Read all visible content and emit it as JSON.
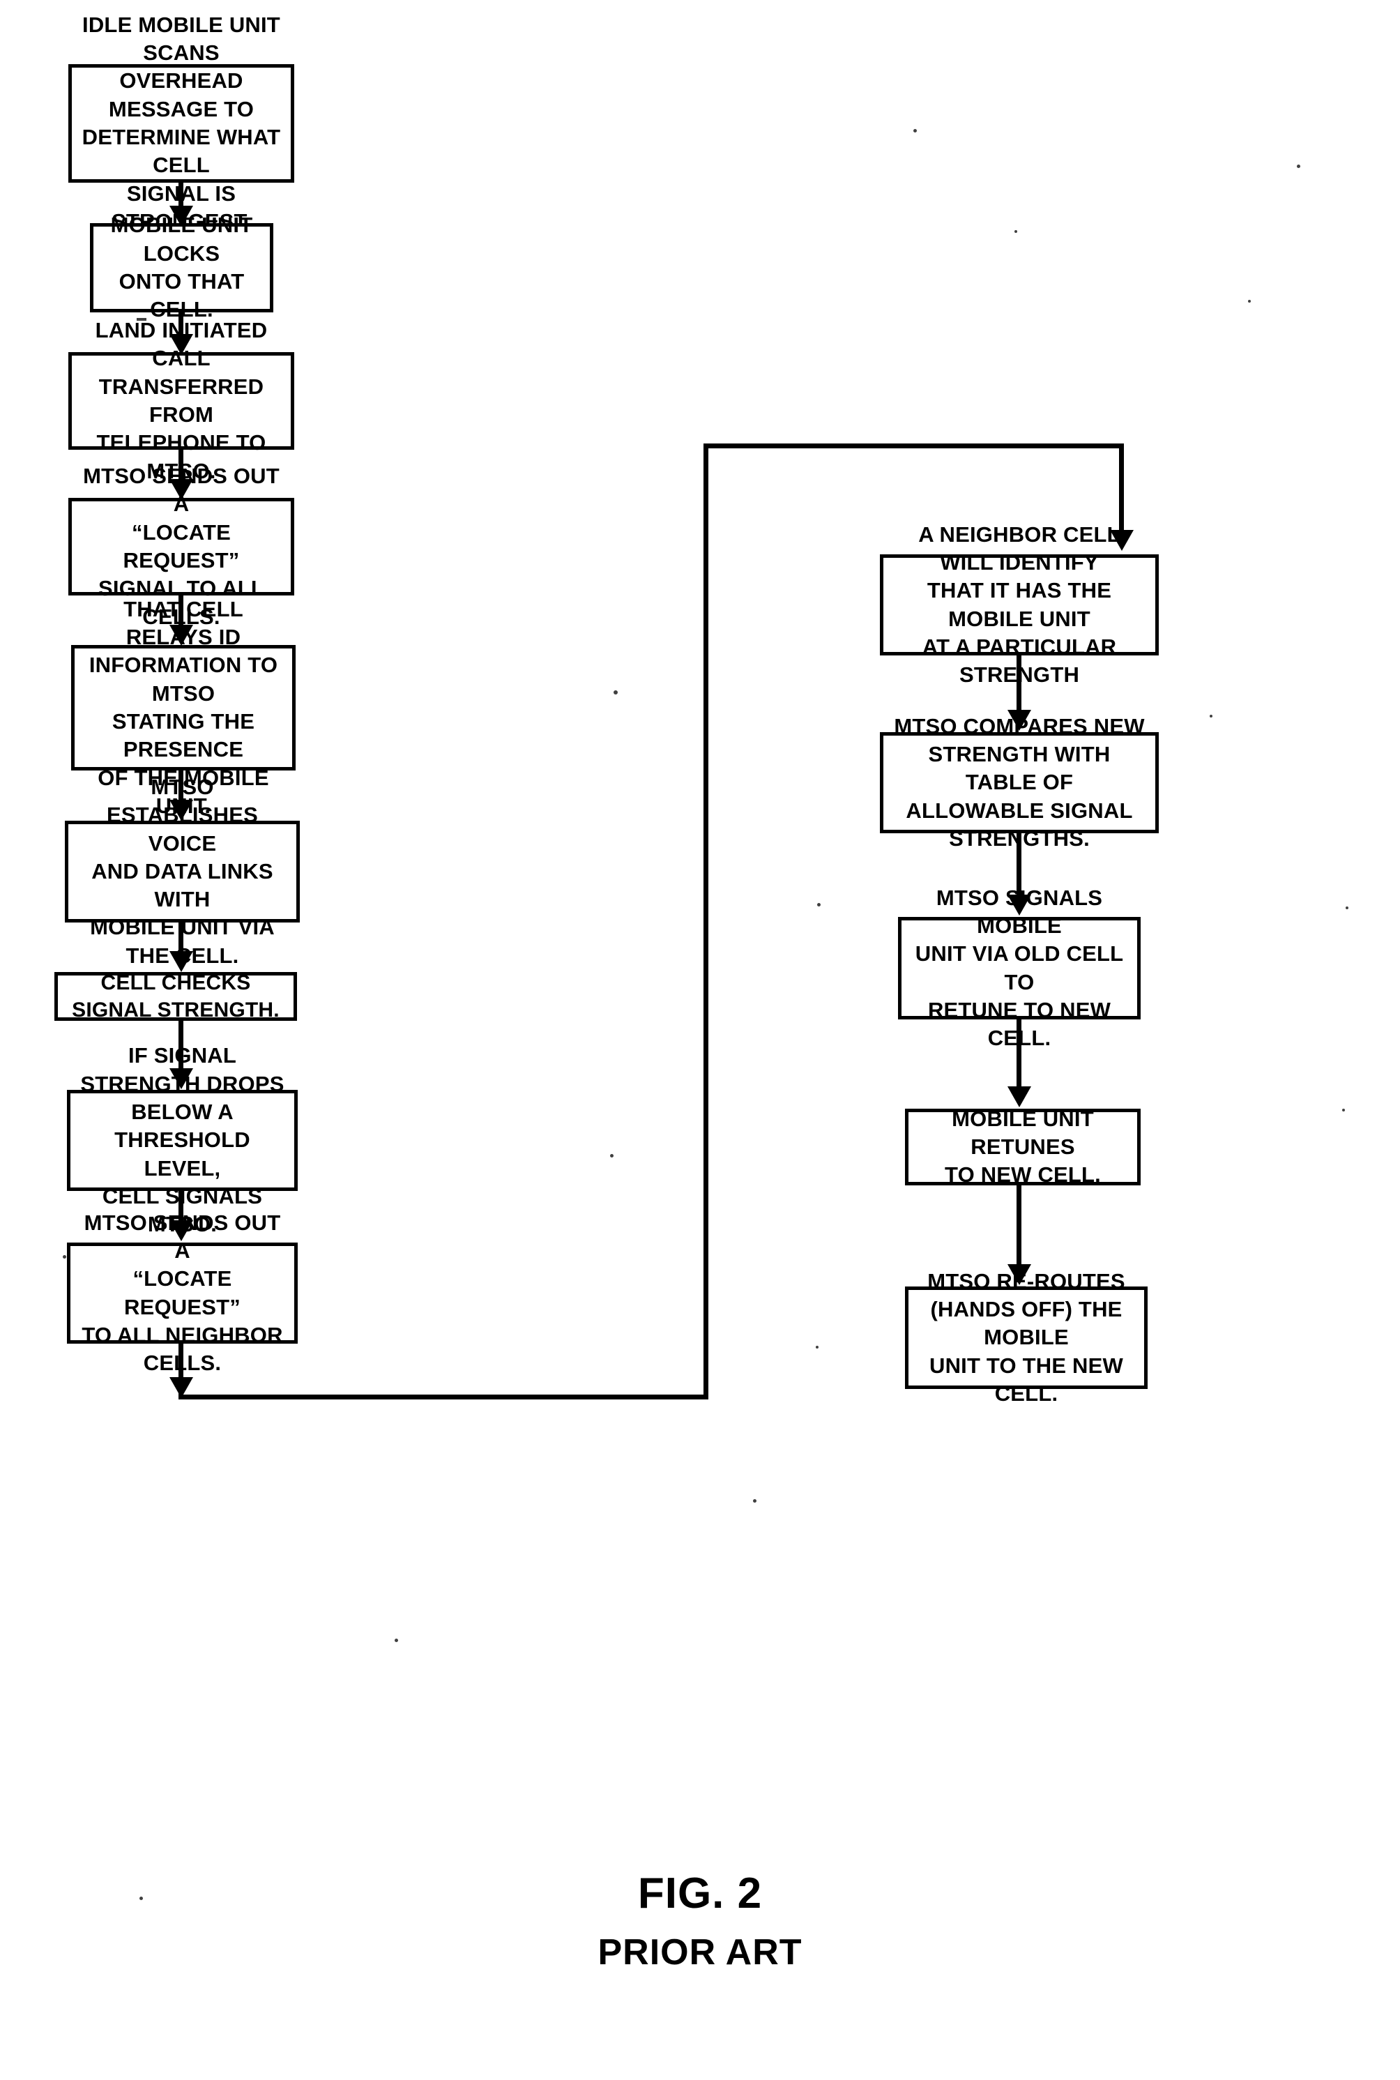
{
  "figure": {
    "number": "FIG. 2",
    "subtitle": "PRIOR ART"
  },
  "flowchart": {
    "type": "flowchart",
    "orientation": "two-column-with-feedback-loop",
    "left_column": [
      {
        "id": "L1",
        "text": "IDLE MOBILE UNIT SCANS\nOVERHEAD MESSAGE TO\nDETERMINE WHAT CELL\nSIGNAL IS STRONGEST."
      },
      {
        "id": "L2",
        "text": "MOBILE UNIT LOCKS\nONTO THAT CELL."
      },
      {
        "id": "L3",
        "text": "LAND INITIATED CALL\nTRANSFERRED FROM\nTELEPHONE TO MTSO."
      },
      {
        "id": "L4",
        "text": "MTSO SENDS OUT A\n“LOCATE  REQUEST”\nSIGNAL TO ALL CELLS."
      },
      {
        "id": "L5",
        "text": "THAT CELL RELAYS ID\nINFORMATION TO MTSO\nSTATING THE PRESENCE\nOF THE MOBILE UNIT."
      },
      {
        "id": "L6",
        "text": "MTSO ESTABLISHES VOICE\nAND DATA LINKS WITH\nMOBILE UNIT VIA THE CELL."
      },
      {
        "id": "L7",
        "text": "CELL CHECKS SIGNAL STRENGTH."
      },
      {
        "id": "L8",
        "text": "IF SIGNAL STRENGTH DROPS\nBELOW A THRESHOLD LEVEL,\nCELL SIGNALS MTSO."
      },
      {
        "id": "L9",
        "text": "MTSO SENDS OUT A\n“LOCATE REQUEST”\nTO ALL NEIGHBOR CELLS."
      }
    ],
    "right_column": [
      {
        "id": "R1",
        "text": "A NEIGHBOR CELL WILL IDENTIFY\nTHAT IT HAS THE MOBILE UNIT\nAT A PARTICULAR STRENGTH"
      },
      {
        "id": "R2",
        "text": "MTSO COMPARES NEW\nSTRENGTH WITH TABLE OF\nALLOWABLE SIGNAL STRENGTHS."
      },
      {
        "id": "R3",
        "text": "MTSO SIGNALS MOBILE\nUNIT VIA OLD CELL TO\nRETUNE TO NEW CELL."
      },
      {
        "id": "R4",
        "text": "MOBILE UNIT RETUNES\nTO NEW CELL."
      },
      {
        "id": "R5",
        "text": "MTSO RE-ROUTES\n(HANDS OFF) THE MOBILE\nUNIT TO THE NEW CELL."
      }
    ],
    "connectors": [
      {
        "from": "L1",
        "to": "L2",
        "style": "arrow-down"
      },
      {
        "from": "L2",
        "to": "L3",
        "style": "arrow-down"
      },
      {
        "from": "L3",
        "to": "L4",
        "style": "arrow-down"
      },
      {
        "from": "L4",
        "to": "L5",
        "style": "arrow-down"
      },
      {
        "from": "L5",
        "to": "L6",
        "style": "arrow-down"
      },
      {
        "from": "L6",
        "to": "L7",
        "style": "arrow-down"
      },
      {
        "from": "L7",
        "to": "L8",
        "style": "arrow-down"
      },
      {
        "from": "L8",
        "to": "L9",
        "style": "arrow-down"
      },
      {
        "from": "L9",
        "to": "R1",
        "style": "loop-right-up-then-down"
      },
      {
        "from": "R1",
        "to": "R2",
        "style": "arrow-down"
      },
      {
        "from": "R2",
        "to": "R3",
        "style": "arrow-down"
      },
      {
        "from": "R3",
        "to": "R4",
        "style": "arrow-down"
      },
      {
        "from": "R4",
        "to": "R5",
        "style": "arrow-down"
      }
    ]
  },
  "colors": {
    "ink": "#000000",
    "paper": "#ffffff"
  }
}
